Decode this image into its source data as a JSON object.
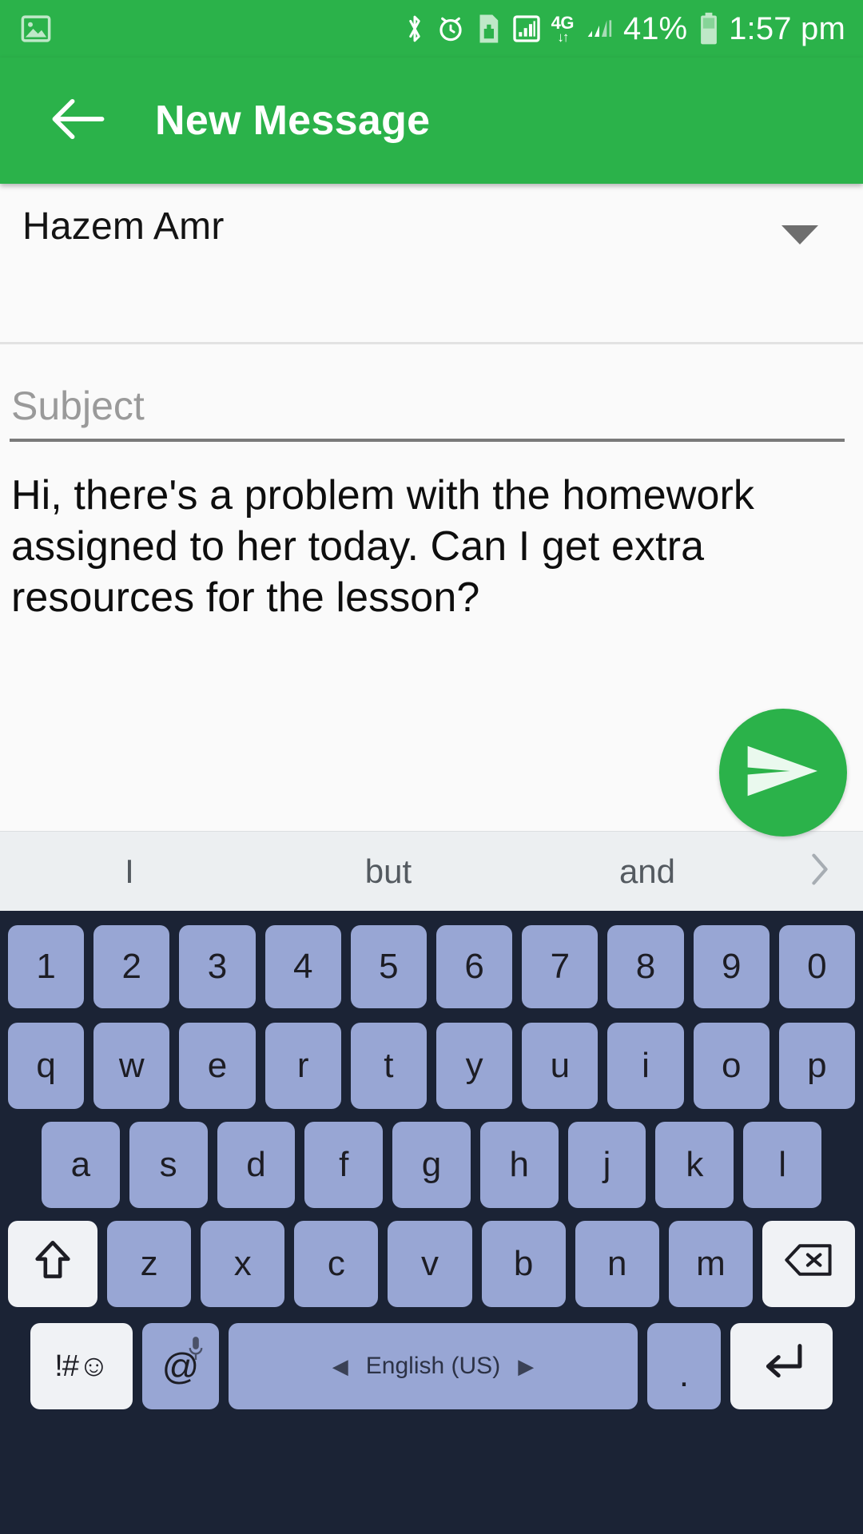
{
  "statusbar": {
    "left_icons": [
      "image-icon"
    ],
    "right_icons": [
      "bluetooth-icon",
      "alarm-icon",
      "sim-card-icon",
      "signal-box-icon",
      "4g-icon",
      "signal-bars-icon",
      "battery-icon"
    ],
    "network_label": "4G",
    "battery_percent": "41%",
    "time": "1:57 pm"
  },
  "appbar": {
    "back_icon": "back-arrow-icon",
    "title": "New Message"
  },
  "compose": {
    "recipient": "Hazem Amr",
    "recipient_caret_icon": "chevron-down-icon",
    "subject_placeholder": "Subject",
    "subject_value": "",
    "body_text": "Hi, there's a problem with the homework assigned to her today. Can I get extra resources for the lesson?",
    "send_icon": "send-icon"
  },
  "suggestions": {
    "items": [
      "I",
      "but",
      "and"
    ],
    "more_icon": "chevron-right-icon"
  },
  "keyboard": {
    "rows": {
      "numbers": [
        "1",
        "2",
        "3",
        "4",
        "5",
        "6",
        "7",
        "8",
        "9",
        "0"
      ],
      "top": [
        "q",
        "w",
        "e",
        "r",
        "t",
        "y",
        "u",
        "i",
        "o",
        "p"
      ],
      "home": [
        "a",
        "s",
        "d",
        "f",
        "g",
        "h",
        "j",
        "k",
        "l"
      ],
      "bottom": [
        "z",
        "x",
        "c",
        "v",
        "b",
        "n",
        "m"
      ]
    },
    "shift_icon": "shift-arrow-icon",
    "backspace_icon": "backspace-icon",
    "symbols_label": "!#☺",
    "at_label": "@",
    "mic_icon": "microphone-icon",
    "space_label": "English (US)",
    "space_left_arrow": "◀",
    "space_right_arrow": "▶",
    "period_label": ".",
    "enter_icon": "enter-key-icon"
  },
  "colors": {
    "brand_green": "#2BB24A",
    "keyboard_bg": "#1b2335",
    "key_blue": "#98a6d4",
    "key_light": "#f0f2f5",
    "suggestion_bg": "#eceff1"
  }
}
